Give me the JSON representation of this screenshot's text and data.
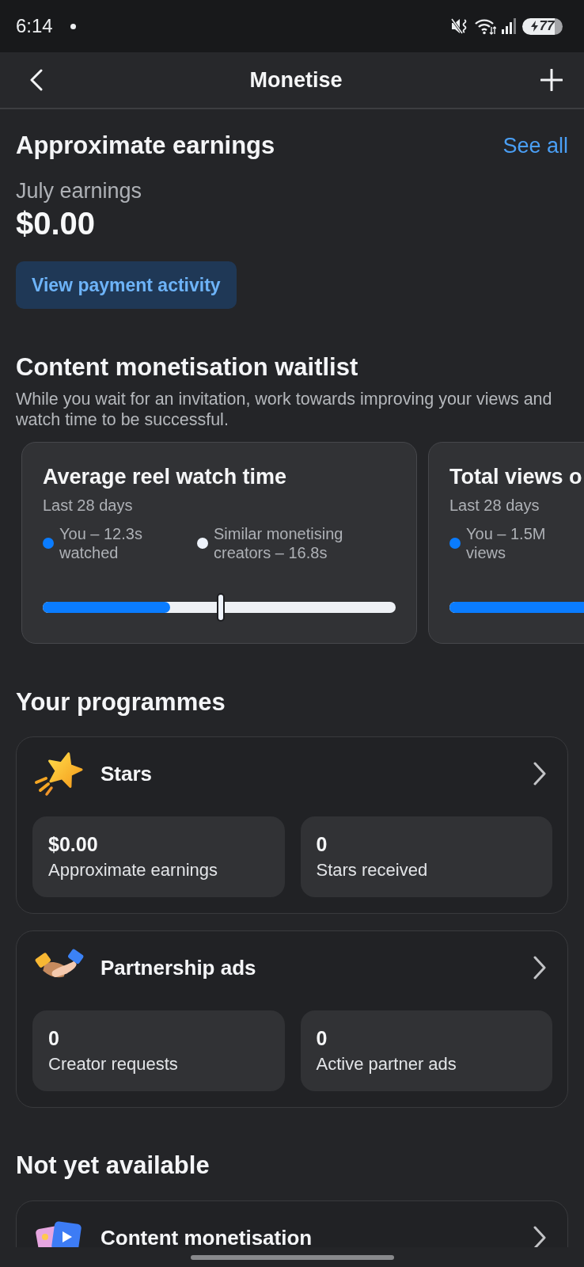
{
  "status_bar": {
    "time": "6:14",
    "battery": "77"
  },
  "header": {
    "title": "Monetise"
  },
  "earnings": {
    "title": "Approximate earnings",
    "link": "See all",
    "period": "July earnings",
    "amount": "$0.00",
    "button": "View payment activity"
  },
  "waitlist": {
    "title": "Content monetisation waitlist",
    "description": "While you wait for an invitation, work towards improving your views and watch time to be successful.",
    "cards": [
      {
        "title": "Average reel watch time",
        "period": "Last 28 days",
        "series": [
          {
            "kind": "fill",
            "label": "You – 12.3s watched",
            "color": "#0a7cff",
            "level": 0.36
          },
          {
            "kind": "marker",
            "label": "Similar monetising creators – 16.8s",
            "color": "#eef3fb",
            "level": 0.505
          }
        ]
      },
      {
        "title": "Total views o",
        "period": "Last 28 days",
        "series": [
          {
            "kind": "fill",
            "label": "You – 1.5M views",
            "color": "#0a7cff",
            "level": 0.8
          }
        ]
      }
    ]
  },
  "programmes": {
    "title": "Your programmes",
    "items": [
      {
        "kind": "star",
        "title": "Stars",
        "stats": [
          {
            "value": "$0.00",
            "label": "Approximate earnings"
          },
          {
            "value": "0",
            "label": "Stars received"
          }
        ]
      },
      {
        "kind": "handshake",
        "title": "Partnership ads",
        "stats": [
          {
            "value": "0",
            "label": "Creator requests"
          },
          {
            "value": "0",
            "label": "Active partner ads"
          }
        ]
      }
    ]
  },
  "not_available": {
    "title": "Not yet available",
    "items": [
      {
        "kind": "media",
        "title": "Content monetisation"
      }
    ]
  }
}
